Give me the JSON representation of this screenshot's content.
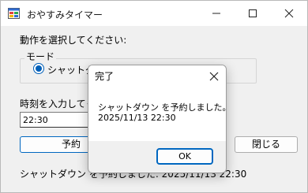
{
  "window": {
    "title": "おやすみタイマー",
    "app_icon": "windows-forms-app-icon"
  },
  "main": {
    "action_prompt": "動作を選択してください:",
    "mode_group_label": "モード",
    "mode_selected": "シャットダウン",
    "time_prompt": "時刻を入力してくだ",
    "time_value": "22:30",
    "reserve_button": "予約",
    "close_button": "閉じる",
    "status_text": "シャットダウン を予約しました: 2025/11/13 22:30"
  },
  "dialog": {
    "title": "完了",
    "message_line1": "シャットダウン を予約しました。",
    "message_line2": "2025/11/13 22:30",
    "ok_button": "OK"
  }
}
